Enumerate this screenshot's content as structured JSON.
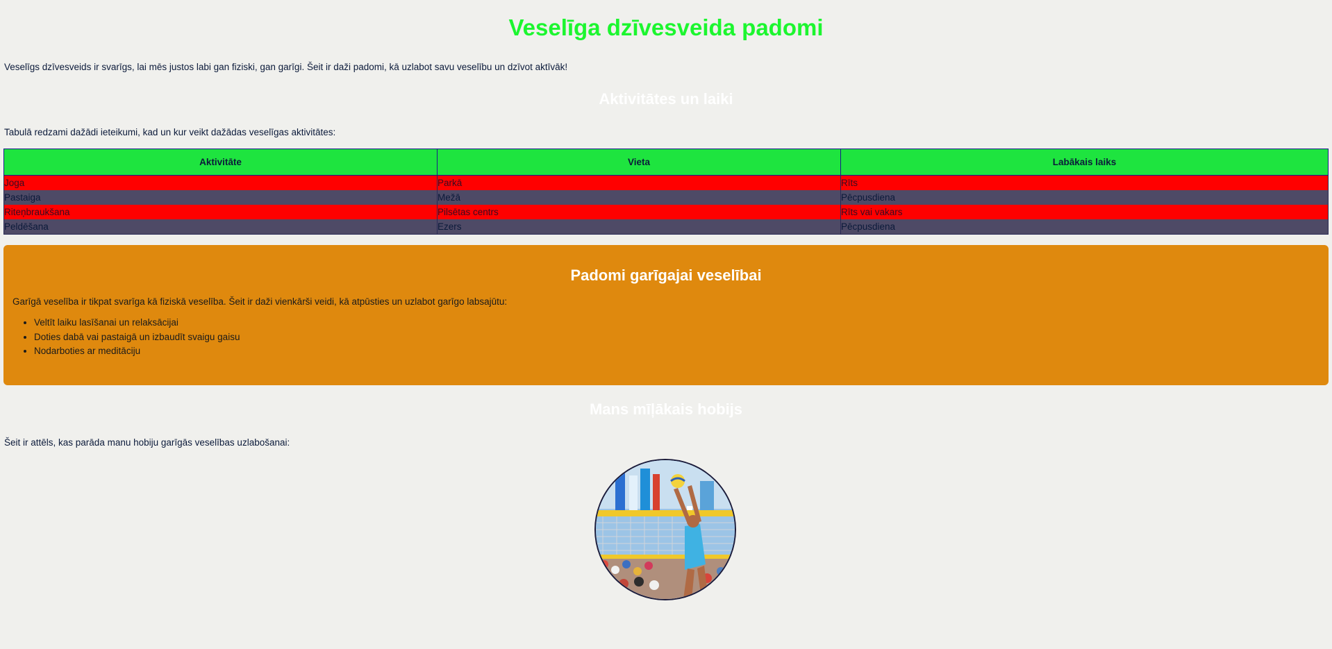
{
  "header": {
    "title": "Veselīga dzīvesveida padomi"
  },
  "intro": {
    "text": "Veselīgs dzīvesveids ir svarīgs, lai mēs justos labi gan fiziski, gan garīgi. Šeit ir daži padomi, kā uzlabot savu veselību un dzīvot aktīvāk!"
  },
  "activities": {
    "heading": "Aktivitātes un laiki",
    "intro": "Tabulā redzami dažādi ieteikumi, kad un kur veikt dažādas veselīgas aktivitātes:",
    "columns": [
      "Aktivitāte",
      "Vieta",
      "Labākais laiks"
    ],
    "rows": [
      [
        "Joga",
        "Parkā",
        "Rīts"
      ],
      [
        "Pastaiga",
        "Mežā",
        "Pēcpusdiena"
      ],
      [
        "Riteņbraukšana",
        "Pilsētas centrs",
        "Rīts vai vakars"
      ],
      [
        "Peldēšana",
        "Ezers",
        "Pēcpusdiena"
      ]
    ]
  },
  "mental": {
    "heading": "Padomi garīgajai veselībai",
    "text": "Garīgā veselība ir tikpat svarīga kā fiziskā veselība. Šeit ir daži vienkārši veidi, kā atpūsties un uzlabot garīgo labsajūtu:",
    "items": [
      "Veltīt laiku lasīšanai un relaksācijai",
      "Doties dabā vai pastaigā un izbaudīt svaigu gaisu",
      "Nodarboties ar meditāciju"
    ]
  },
  "hobby": {
    "heading": "Mans mīļākais hobijs",
    "intro": "Šeit ir attēls, kas parāda manu hobiju garīgās veselības uzlabošanai:",
    "image_subject": "volleyball-player-photo"
  },
  "colors": {
    "title": "#1cf62f",
    "table_header": "#1ee43f",
    "row_odd": "#ff0000",
    "row_even": "#4e4a66",
    "mental_box": "#df890e"
  }
}
